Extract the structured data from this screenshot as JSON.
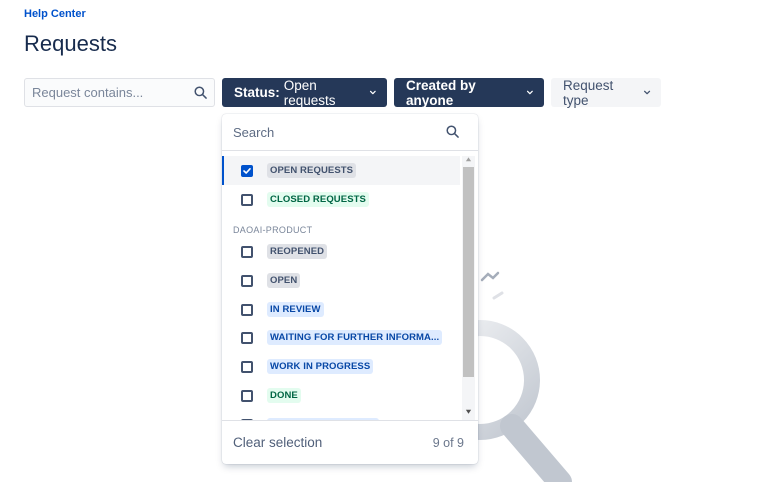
{
  "breadcrumb": "Help Center",
  "page_title": "Requests",
  "filters": {
    "search_placeholder": "Request contains...",
    "status_key": "Status:",
    "status_value": "Open requests",
    "created_label": "Created by anyone",
    "request_type_label": "Request type"
  },
  "dropdown": {
    "search_placeholder": "Search",
    "group_label": "DAOAI-PRODUCT",
    "options": [
      {
        "label": "OPEN REQUESTS",
        "checked": true,
        "style": "default"
      },
      {
        "label": "CLOSED REQUESTS",
        "checked": false,
        "style": "success"
      },
      {
        "label": "REOPENED",
        "checked": false,
        "style": "default"
      },
      {
        "label": "OPEN",
        "checked": false,
        "style": "default"
      },
      {
        "label": "IN REVIEW",
        "checked": false,
        "style": "inprogress"
      },
      {
        "label": "WAITING FOR FURTHER INFORMA...",
        "checked": false,
        "style": "inprogress"
      },
      {
        "label": "WORK IN PROGRESS",
        "checked": false,
        "style": "inprogress"
      },
      {
        "label": "DONE",
        "checked": false,
        "style": "success"
      }
    ],
    "clear_label": "Clear selection",
    "count": "9 of 9"
  },
  "colors": {
    "link": "#0052cc",
    "dark_button": "#253858",
    "checkbox_checked": "#0052cc"
  },
  "icons": {
    "search": "search-icon",
    "chevron": "chevron-down-icon"
  }
}
